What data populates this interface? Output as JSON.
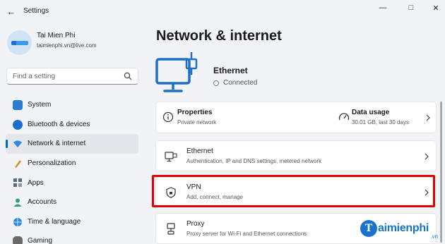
{
  "window": {
    "title": "Settings",
    "controls": [
      "minimize",
      "maximize",
      "close"
    ]
  },
  "user": {
    "name": "Tai Mien Phi",
    "email": "taimienphi.vn@live.com"
  },
  "search": {
    "placeholder": "Find a setting",
    "icon": "search-icon"
  },
  "sidebar": {
    "items": [
      {
        "label": "System",
        "icon": "system-icon",
        "color": "#2a7bd3",
        "active": false
      },
      {
        "label": "Bluetooth & devices",
        "icon": "bluetooth-icon",
        "color": "#1a6fce",
        "active": false
      },
      {
        "label": "Network & internet",
        "icon": "wifi-icon",
        "color": "#2b8ae0",
        "active": true
      },
      {
        "label": "Personalization",
        "icon": "brush-icon",
        "color": "#e08a2b",
        "active": false
      },
      {
        "label": "Apps",
        "icon": "apps-icon",
        "color": "#5a6a7a",
        "active": false
      },
      {
        "label": "Accounts",
        "icon": "accounts-icon",
        "color": "#2ba36a",
        "active": false
      },
      {
        "label": "Time & language",
        "icon": "globe-icon",
        "color": "#2b8ae0",
        "active": false
      },
      {
        "label": "Gaming",
        "icon": "gaming-icon",
        "color": "#6a6a6a",
        "active": false
      }
    ]
  },
  "main": {
    "title": "Network & internet",
    "connection": {
      "name": "Ethernet",
      "status": "Connected",
      "icon": "ethernet-monitor-icon"
    },
    "summary": [
      {
        "title": "Properties",
        "subtitle": "Private network",
        "icon": "info-icon"
      },
      {
        "title": "Data usage",
        "subtitle": "30.01 GB, last 30 days",
        "icon": "gauge-icon"
      }
    ],
    "cards": [
      {
        "title": "Ethernet",
        "subtitle": "Authentication, IP and DNS settings, metered network",
        "icon": "ethernet-icon"
      },
      {
        "title": "VPN",
        "subtitle": "Add, connect, manage",
        "icon": "shield-icon"
      },
      {
        "title": "Proxy",
        "subtitle": "Proxy server for Wi-Fi and Ethernet connections",
        "icon": "proxy-icon"
      }
    ]
  },
  "watermark": {
    "text": "aimienphi",
    "letter": "T",
    "suffix": ".vn"
  },
  "colors": {
    "accent": "#0067c0",
    "highlight": "#e00000",
    "brand": "#1a73c8"
  }
}
